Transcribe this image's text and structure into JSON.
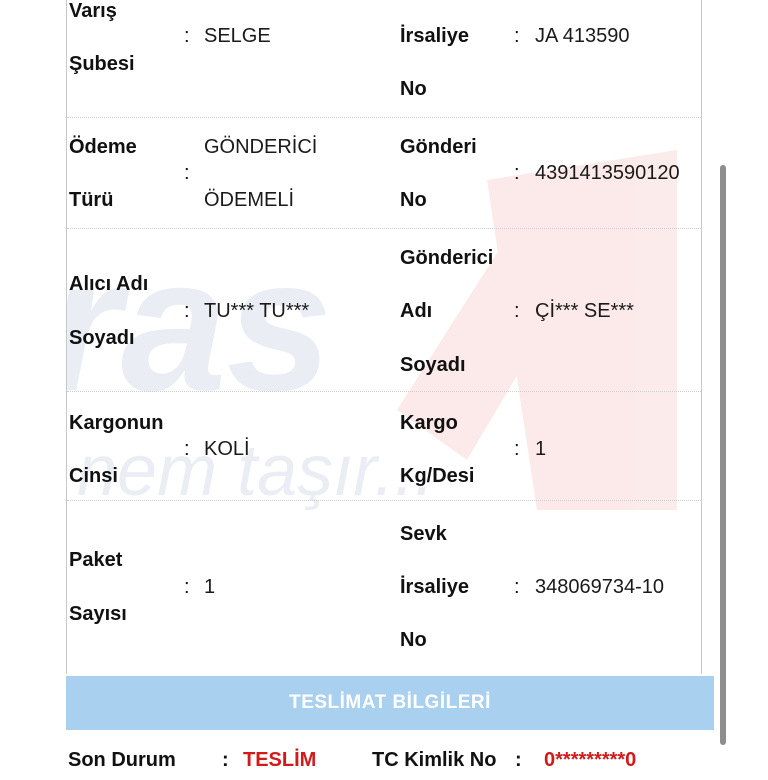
{
  "shipment": {
    "rows": [
      {
        "left_label": [
          "Varış",
          "Şubesi"
        ],
        "left_value": [
          "SELGE"
        ],
        "right_label": [
          "İrsaliye",
          "No"
        ],
        "right_value": [
          "JA 413590"
        ]
      },
      {
        "left_label": [
          "Ödeme",
          "Türü"
        ],
        "left_value": [
          "GÖNDERİCİ",
          "ÖDEMELİ"
        ],
        "right_label": [
          "Gönderi",
          "No"
        ],
        "right_value": [
          "4391413590120"
        ]
      },
      {
        "left_label": [
          "Alıcı Adı",
          "Soyadı"
        ],
        "left_value": [
          "TU*** TU***"
        ],
        "right_label": [
          "Gönderici",
          "Adı",
          "Soyadı"
        ],
        "right_value": [
          "Çİ*** SE***"
        ]
      },
      {
        "left_label": [
          "Kargonun",
          "Cinsi"
        ],
        "left_value": [
          "KOLİ"
        ],
        "right_label": [
          "Kargo",
          "Kg/Desi"
        ],
        "right_value": [
          "1"
        ]
      },
      {
        "left_label": [
          "Paket",
          "Sayısı"
        ],
        "left_value": [
          "1"
        ],
        "right_label": [
          "Sevk",
          "İrsaliye",
          "No"
        ],
        "right_value": [
          "348069734-10"
        ]
      }
    ],
    "separator": ":"
  },
  "delivery": {
    "section_title": "TESLİMAT BİLGİLERİ",
    "status_label": "Son Durum",
    "status_value": "TESLİM",
    "tc_label": "TC Kimlik No",
    "tc_value": "0*********0"
  },
  "watermark": {
    "brand_text": "ras",
    "slogan_text": "nem taşır...",
    "color": "#1f4e8c",
    "accent": "#e02020"
  },
  "colors": {
    "section_bar": "#a9d0ef",
    "status_red": "#d11a1a"
  }
}
